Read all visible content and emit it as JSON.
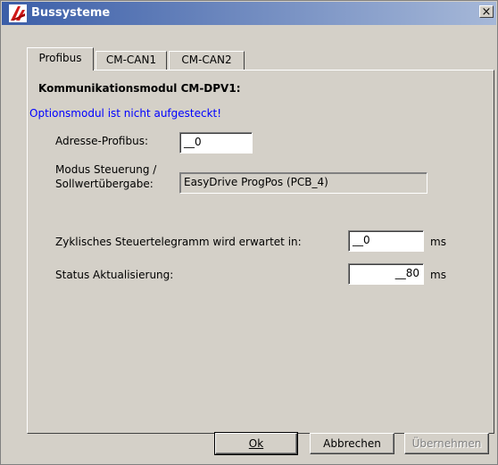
{
  "window": {
    "title": "Bussysteme",
    "close_label": "×"
  },
  "tabs": [
    {
      "label": "Profibus",
      "active": true
    },
    {
      "label": "CM-CAN1",
      "active": false
    },
    {
      "label": "CM-CAN2",
      "active": false
    }
  ],
  "profibus": {
    "module_heading": "Kommunikationsmodul CM-DPV1:",
    "warning": "Optionsmodul ist nicht aufgesteckt!",
    "address_label": "Adresse-Profibus:",
    "address_value": "__0",
    "mode_label_line1": "Modus Steuerung /",
    "mode_label_line2": "Sollwertübergabe:",
    "mode_value": "EasyDrive ProgPos   (PCB_4)",
    "cyclic_label": "Zyklisches Steuertelegramm wird erwartet in:",
    "cyclic_value": "__0",
    "cyclic_unit": "ms",
    "status_label": "Status Aktualisierung:",
    "status_value": "__80",
    "status_unit": "ms"
  },
  "buttons": {
    "ok": "Ok",
    "cancel": "Abbrechen",
    "apply": "Übernehmen"
  },
  "colors": {
    "titlebar_start": "#3b5ea8",
    "titlebar_end": "#a6b8d8",
    "warning": "#0000ff"
  }
}
